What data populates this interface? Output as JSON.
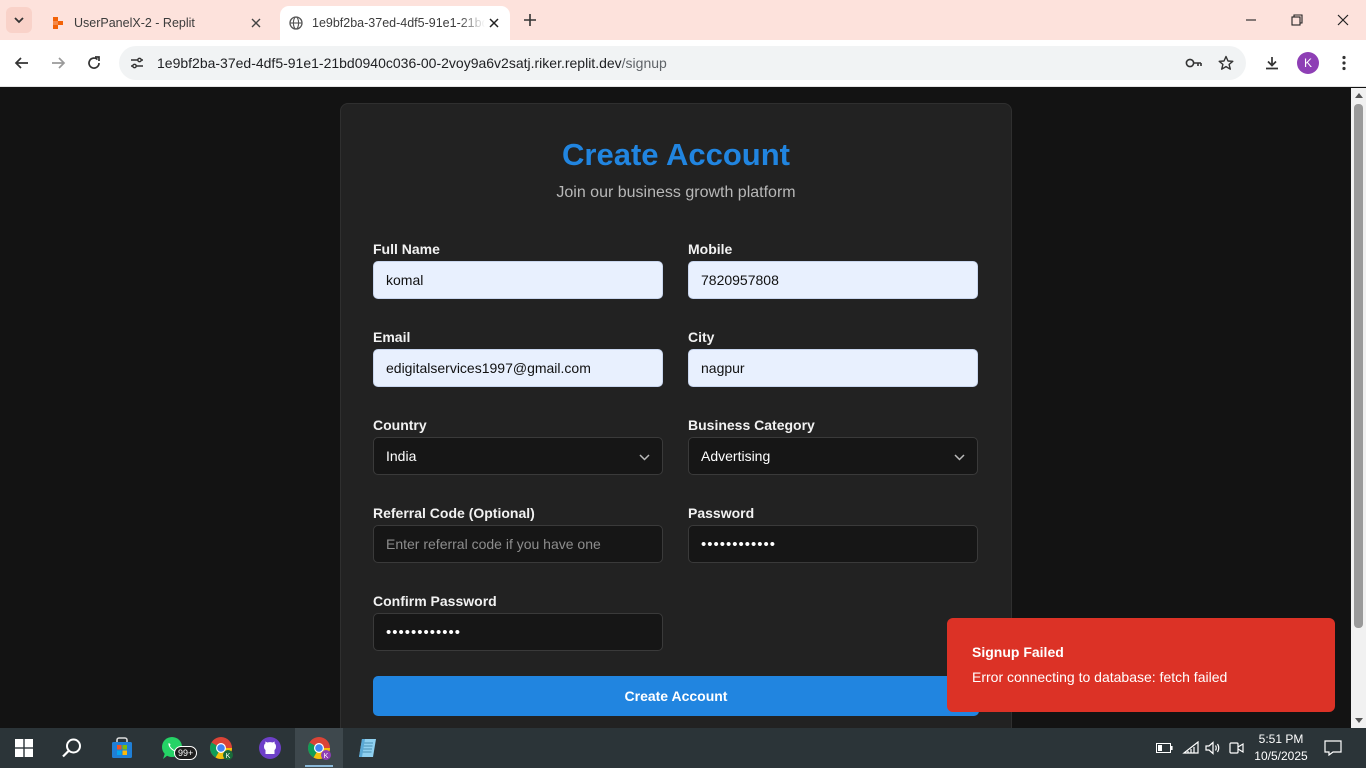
{
  "browser": {
    "tabs": [
      {
        "title": "UserPanelX-2 - Replit",
        "active": false
      },
      {
        "title": "1e9bf2ba-37ed-4df5-91e1-21bd0940c036-00-2voy9a6v2satj.riker.replit.dev",
        "active": true
      }
    ],
    "url_host": "1e9bf2ba-37ed-4df5-91e1-21bd0940c036-00-2voy9a6v2satj.riker.replit.dev",
    "url_path": "/signup",
    "profile_initial": "K"
  },
  "form": {
    "title": "Create Account",
    "subtitle": "Join our business growth platform",
    "full_name": {
      "label": "Full Name",
      "value": "komal"
    },
    "mobile": {
      "label": "Mobile",
      "value": "7820957808"
    },
    "email": {
      "label": "Email",
      "value": "edigitalservices1997@gmail.com"
    },
    "city": {
      "label": "City",
      "value": "nagpur"
    },
    "country": {
      "label": "Country",
      "value": "India"
    },
    "business_category": {
      "label": "Business Category",
      "value": "Advertising"
    },
    "referral": {
      "label": "Referral Code (Optional)",
      "placeholder": "Enter referral code if you have one"
    },
    "password": {
      "label": "Password",
      "value": "••••••••••••"
    },
    "confirm_password": {
      "label": "Confirm Password",
      "value": "••••••••••••"
    },
    "submit_label": "Create Account"
  },
  "toast": {
    "title": "Signup Failed",
    "message": "Error connecting to database: fetch failed"
  },
  "taskbar": {
    "whatsapp_badge": "99+",
    "time": "5:51 PM",
    "date": "10/5/2025"
  },
  "colors": {
    "accent": "#2185e0",
    "error": "#dc3226",
    "card_bg": "#222222",
    "page_bg": "#131313",
    "tabbar_bg": "#fde2dc"
  }
}
